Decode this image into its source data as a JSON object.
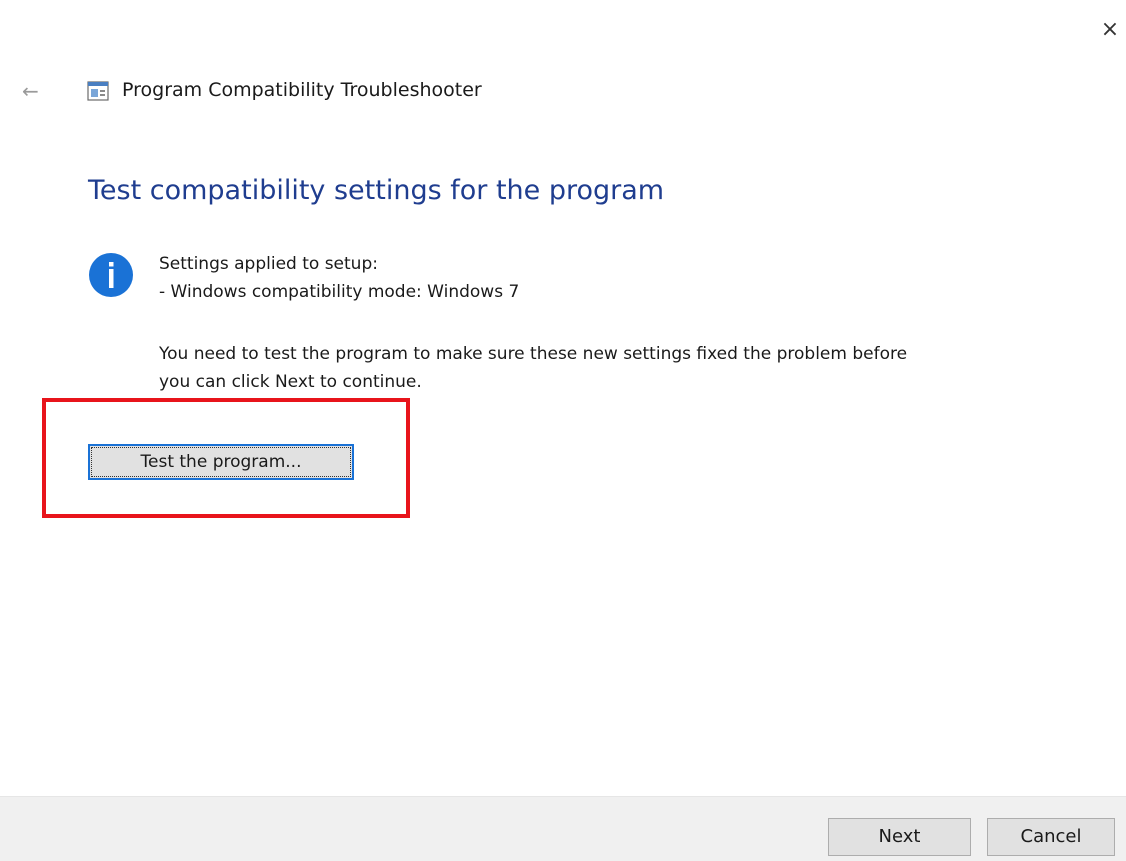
{
  "window": {
    "close_glyph": "×",
    "back_glyph": "←",
    "app_title": "Program Compatibility Troubleshooter",
    "app_icon": "troubleshooter-app-icon"
  },
  "main": {
    "title": "Test compatibility settings for the program",
    "info_icon": "info-icon",
    "settings_heading": "Settings applied to setup:",
    "settings_line": "- Windows compatibility mode: Windows 7",
    "instructions_line1": "You need to test the program to make sure these new settings fixed the problem before",
    "instructions_line2": "you can click Next to continue.",
    "test_button_label": "Test the program...",
    "highlight_color": "#e8141b"
  },
  "footer": {
    "next_label": "Next",
    "cancel_label": "Cancel"
  },
  "colors": {
    "title_blue": "#1f3d8f",
    "info_blue": "#1a72d6",
    "footer_bg": "#f0f0f0"
  }
}
